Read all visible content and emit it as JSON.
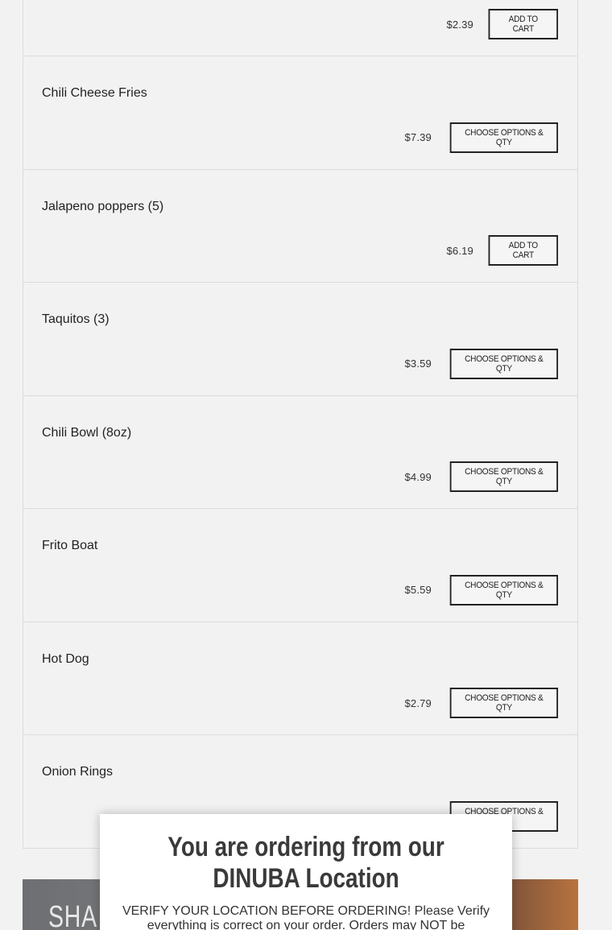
{
  "menu": {
    "items": [
      {
        "name": "",
        "price": "$2.39",
        "button": "ADD TO CART"
      },
      {
        "name": "Chili Cheese Fries",
        "price": "$7.39",
        "button": "CHOOSE OPTIONS & QTY"
      },
      {
        "name": "Jalapeno poppers (5)",
        "price": "$6.19",
        "button": "ADD TO CART"
      },
      {
        "name": "Taquitos (3)",
        "price": "$3.59",
        "button": "CHOOSE OPTIONS & QTY"
      },
      {
        "name": "Chili Bowl (8oz)",
        "price": "$4.99",
        "button": "CHOOSE OPTIONS & QTY"
      },
      {
        "name": "Frito Boat",
        "price": "$5.59",
        "button": "CHOOSE OPTIONS & QTY"
      },
      {
        "name": "Hot Dog",
        "price": "$2.79",
        "button": "CHOOSE OPTIONS & QTY"
      },
      {
        "name": "Onion Rings",
        "price": "",
        "button": "CHOOSE OPTIONS & QTY"
      }
    ]
  },
  "promo": {
    "text": "SHA"
  },
  "modal": {
    "title": "You are ordering from our DINUBA Location",
    "body": "VERIFY YOUR LOCATION BEFORE ORDERING! Please Verify everything is correct on your order. Orders may NOT be"
  }
}
